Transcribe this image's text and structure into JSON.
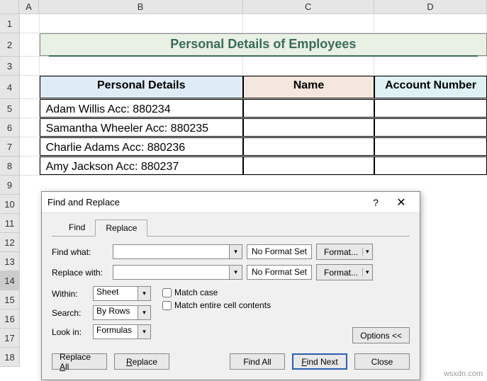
{
  "columns": [
    "A",
    "B",
    "C",
    "D"
  ],
  "rows": [
    "1",
    "2",
    "3",
    "4",
    "5",
    "6",
    "7",
    "8",
    "9",
    "10",
    "11",
    "12",
    "13",
    "14",
    "15",
    "16",
    "17",
    "18"
  ],
  "title": "Personal Details of Employees",
  "table": {
    "headers": [
      "Personal Details",
      "Name",
      "Account Number"
    ],
    "rows": [
      {
        "details": "Adam Willis Acc: 880234",
        "name": "",
        "acc": ""
      },
      {
        "details": "Samantha Wheeler Acc: 880235",
        "name": "",
        "acc": ""
      },
      {
        "details": "Charlie Adams Acc: 880236",
        "name": "",
        "acc": ""
      },
      {
        "details": "Amy Jackson Acc: 880237",
        "name": "",
        "acc": ""
      }
    ]
  },
  "dialog": {
    "title": "Find and Replace",
    "tabs": {
      "find": "Find",
      "replace": "Replace"
    },
    "labels": {
      "findwhat": "Find what:",
      "replacewith": "Replace with:",
      "within": "Within:",
      "search": "Search:",
      "lookin": "Look in:"
    },
    "values": {
      "findwhat": "",
      "replacewith": "",
      "within": "Sheet",
      "search": "By Rows",
      "lookin": "Formulas"
    },
    "fmt_none": "No Format Set",
    "fmt_btn": "Format...",
    "checks": {
      "matchcase": "Match case",
      "matchcell": "Match entire cell contents"
    },
    "options_btn": "Options <<",
    "buttons": {
      "replaceall": "Replace All",
      "replace": "Replace",
      "findall": "Find All",
      "findnext": "Find Next",
      "close": "Close"
    }
  },
  "watermark": "wsxdn.com"
}
